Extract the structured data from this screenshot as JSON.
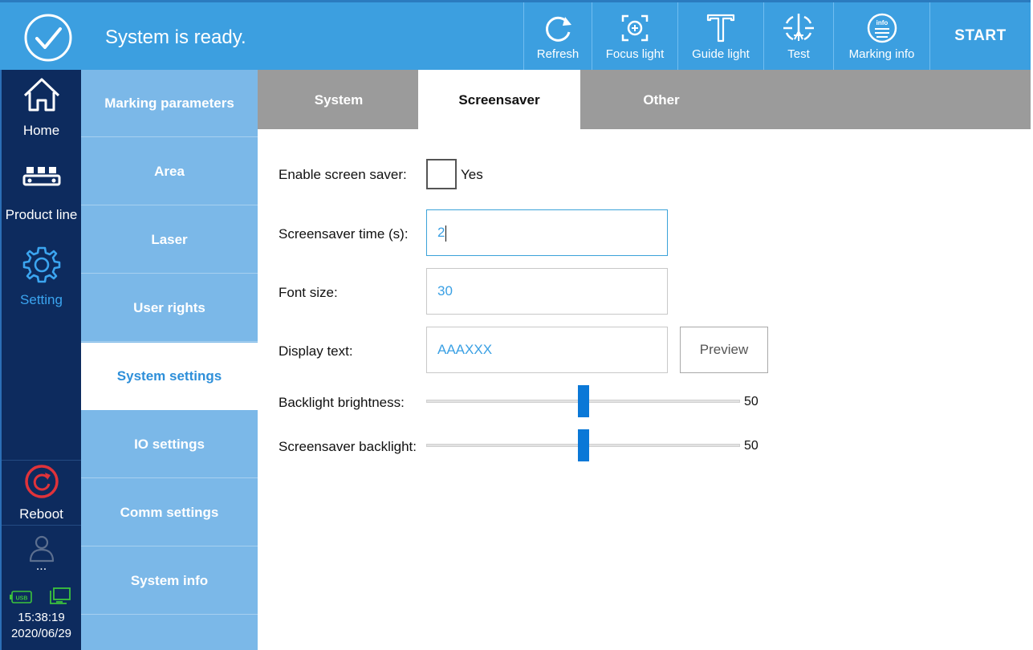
{
  "status": {
    "text": "System is ready."
  },
  "toolbar": [
    {
      "label": "Refresh",
      "icon": "refresh-icon"
    },
    {
      "label": "Focus light",
      "icon": "focus-light-icon"
    },
    {
      "label": "Guide light",
      "icon": "guide-light-icon"
    },
    {
      "label": "Test",
      "icon": "test-icon"
    },
    {
      "label": "Marking info",
      "icon": "marking-info-icon",
      "icon_text": "info"
    }
  ],
  "start_label": "START",
  "leftnav": {
    "items": [
      {
        "label": "Home",
        "icon": "home-icon"
      },
      {
        "label": "Product line",
        "icon": "product-line-icon"
      },
      {
        "label": "Setting",
        "icon": "gear-icon",
        "active": true
      }
    ],
    "reboot": {
      "label": "Reboot",
      "icon": "reboot-icon"
    },
    "user": {
      "label": "...",
      "icon": "user-icon"
    },
    "usb_icon_text": "USB",
    "time": "15:38:19",
    "date": "2020/06/29"
  },
  "subnav": {
    "items": [
      {
        "label": "Marking parameters"
      },
      {
        "label": "Area"
      },
      {
        "label": "Laser"
      },
      {
        "label": "User rights"
      },
      {
        "label": "System settings",
        "active": true
      },
      {
        "label": "IO settings"
      },
      {
        "label": "Comm settings"
      },
      {
        "label": "System info"
      }
    ]
  },
  "tabs": [
    {
      "label": "System"
    },
    {
      "label": "Screensaver",
      "active": true
    },
    {
      "label": "Other"
    }
  ],
  "form": {
    "enable_label": "Enable screen saver:",
    "enable_option": "Yes",
    "enable_checked": false,
    "time_label": "Screensaver time (s):",
    "time_value": "2",
    "font_label": "Font size:",
    "font_value": "30",
    "display_label": "Display text:",
    "display_value": "AAAXXX",
    "preview_label": "Preview",
    "brightness_label": "Backlight brightness:",
    "brightness_value": "50",
    "ss_backlight_label": "Screensaver backlight:",
    "ss_backlight_value": "50"
  },
  "colors": {
    "topbar": "#3c9fe0",
    "leftnav": "#0d2b5e",
    "subnav": "#7bb8e8",
    "accent": "#2e8fd9",
    "slider_thumb": "#0a78d7",
    "reboot": "#e0333a"
  }
}
